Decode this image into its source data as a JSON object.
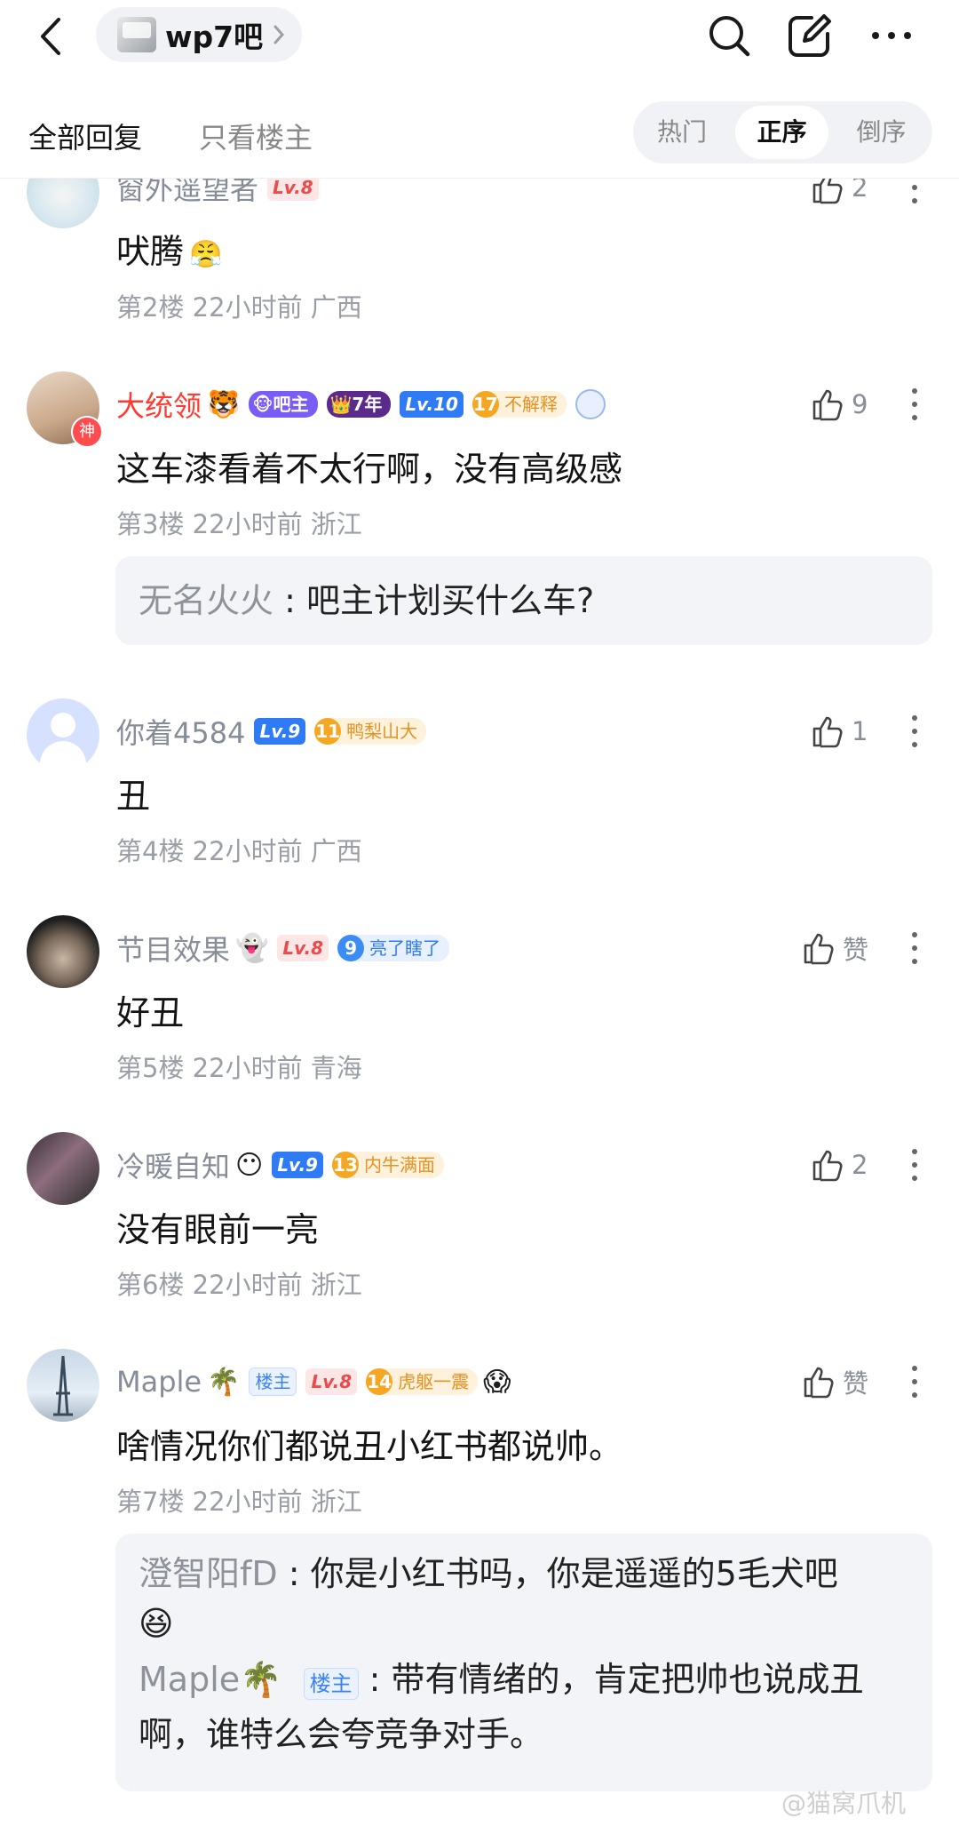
{
  "header": {
    "forum_name": "wp7吧",
    "colors": {
      "icon": "#1a1a1a"
    }
  },
  "tabs": {
    "all_replies": "全部回复",
    "only_op": "只看楼主",
    "sort": [
      "热门",
      "正序",
      "倒序"
    ],
    "sort_selected": "正序"
  },
  "posts": [
    {
      "username": "窗外遥望者",
      "level": "Lv.8",
      "content": "吠腾",
      "content_emoji": "😤",
      "meta": "第2楼 22小时前 广西",
      "likes": "2"
    },
    {
      "username": "大统领",
      "name_emoji": "🐯",
      "badge_admin": "吧主",
      "badge_year": "7年",
      "level": "Lv.10",
      "title_num": "17",
      "title_name": "不解释",
      "avatar_tag": "神",
      "content": "这车漆看着不太行啊，没有高级感",
      "meta": "第3楼 22小时前 浙江",
      "likes": "9",
      "sub_reply": {
        "name": "无名火火",
        "text": "吧主计划买什么车?"
      }
    },
    {
      "username": "你着4584",
      "level": "Lv.9",
      "title_num": "11",
      "title_name": "鸭梨山大",
      "content": "丑",
      "meta": "第4楼 22小时前 广西",
      "likes": "1"
    },
    {
      "username": "节目效果",
      "name_emoji": "👻",
      "level": "Lv.8",
      "title_num": "9",
      "title_name": "亮了瞎了",
      "content": "好丑",
      "meta": "第5楼 22小时前 青海",
      "likes": "赞"
    },
    {
      "username": "冷暖自知",
      "name_emoji": "😶",
      "level": "Lv.9",
      "title_num": "13",
      "title_name": "内牛满面",
      "content": "没有眼前一亮",
      "meta": "第6楼 22小时前 浙江",
      "likes": "2"
    },
    {
      "username": "Maple",
      "name_emoji": "🌴",
      "op_tag": "楼主",
      "level": "Lv.8",
      "title_num": "14",
      "title_name": "虎躯一震",
      "tail_emoji": "😱",
      "content": "啥情况你们都说丑小红书都说帅。",
      "meta": "第7楼 22小时前 浙江",
      "likes": "赞",
      "sub_replies": [
        {
          "name": "澄智阳fD",
          "text": "你是小红书吗，你是遥遥的5毛犬吧",
          "emoji": "😆"
        },
        {
          "name": "Maple",
          "emoji": "🌴",
          "tag": "楼主",
          "text": "带有情绪的，肯定把帅也说成丑",
          "text2": "啊，谁特么会夸竞争对手。"
        }
      ]
    }
  ],
  "watermark": "@猫窝爪机"
}
